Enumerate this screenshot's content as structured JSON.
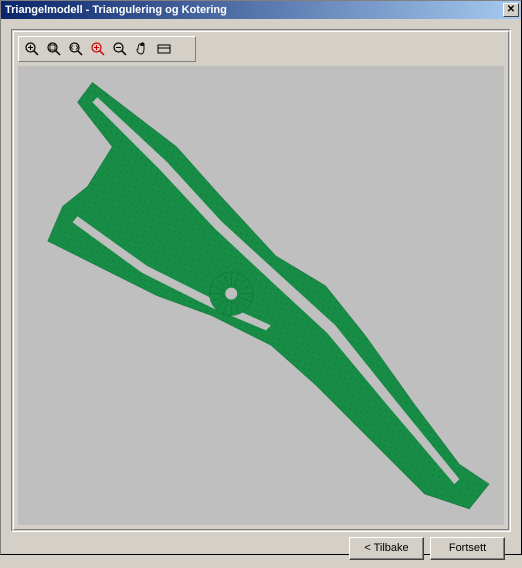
{
  "window": {
    "title": "Triangelmodell - Triangulering og Kotering"
  },
  "toolbar": {
    "icons": [
      "zoom-in",
      "zoom-window",
      "zoom-extents",
      "zoom-in-red",
      "zoom-out",
      "pan",
      "options"
    ]
  },
  "footer": {
    "back_label": "< Tilbake",
    "continue_label": "Fortsett"
  },
  "model": {
    "fill": "#189048"
  }
}
